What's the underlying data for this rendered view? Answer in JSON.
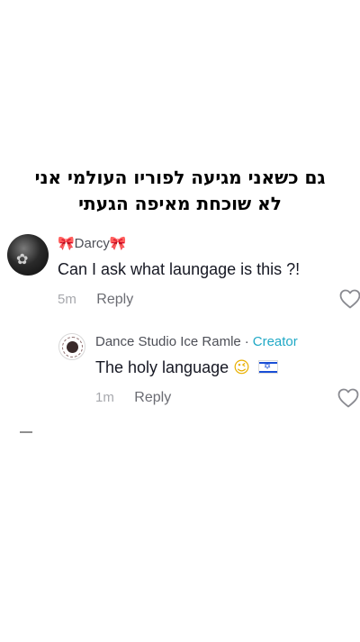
{
  "caption": {
    "line1": "גם כשאני מגיעה לפוריו העולמי אני",
    "line2": "לא שוכחת מאיפה הגעתי"
  },
  "comments": [
    {
      "username": "🎀Darcy🎀",
      "text": "Can I ask what laungage is this ?!",
      "time": "5m",
      "reply_label": "Reply",
      "avatar_icon": "user-avatar-dark"
    }
  ],
  "reply": {
    "username": "Dance Studio Ice Ramle",
    "separator": "·",
    "badge": "Creator",
    "text": "The holy language",
    "emoji": "😉",
    "flag": "israel-flag",
    "time": "1m",
    "reply_label": "Reply"
  },
  "colors": {
    "creator_badge": "#20a9c6",
    "meta_gray": "#a7a8ad",
    "text_dark": "#161823"
  }
}
